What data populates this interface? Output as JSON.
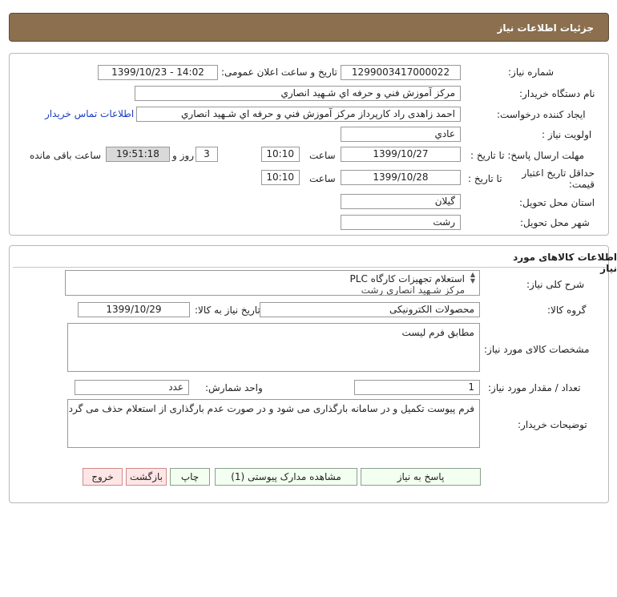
{
  "header": {
    "title": "جزئیات اطلاعات نیاز"
  },
  "details": {
    "need_number_label": "شماره نیاز:",
    "need_number": "1299003417000022",
    "announce_label": "تاریخ و ساعت اعلان عمومی:",
    "announce_value": "1399/10/23 - 14:02",
    "buyer_org_label": "نام دستگاه خریدار:",
    "buyer_org": "مرکز آموزش فني و حرفه اي شـهيد انصاري",
    "requester_label": "ایجاد کننده درخواست:",
    "requester": "احمد زاهدی راد کارپرداز مرکز آموزش فني و حرفه اي شـهيد انصاري",
    "contact_link": "اطلاعات تماس خریدار",
    "priority_label": "اولویت نیاز :",
    "priority": "عادي",
    "deadline_label": "مهلت ارسال پاسخ: تا تاریخ :",
    "deadline_date": "1399/10/27",
    "time_label": "ساعت",
    "deadline_time": "10:10",
    "days_label": "روز و",
    "days_value": "3",
    "remaining_label": "ساعت باقی مانده",
    "remaining_time": "19:51:18",
    "validity_label": "حداقل تاریخ اعتبار قیمت:",
    "validity_to_label": "تا تاریخ :",
    "validity_date": "1399/10/28",
    "validity_time_label": "ساعت",
    "validity_time": "10:10",
    "province_label": "استان محل تحویل:",
    "province": "گیلان",
    "city_label": "شهر محل تحویل:",
    "city": "رشت"
  },
  "goods": {
    "section_title": "اطلاعات کالاهای مورد نیاز",
    "summary_label": "شرح کلی نیاز:",
    "summary_line1": "استعلام  تجهیزات کارگاه PLC",
    "summary_line2": "مرکز شـهيد انصاري رشت",
    "group_label": "گروه کالا:",
    "group_value": "محصولات الکترونیکی",
    "need_date_label": "تاریخ نیاز به کالا:",
    "need_date": "1399/10/29",
    "spec_label": "مشخصات کالای مورد نیاز:",
    "spec_value": "مطابق فرم لیست",
    "qty_label": "تعداد / مقدار مورد نیاز:",
    "qty_value": "1",
    "unit_label": "واحد شمارش:",
    "unit_value": "عدد",
    "buyer_notes_label": "توضیحات خریدار:",
    "buyer_notes": "فرم پیوست تکمیل و در سامانه بارگذاری می شود و در صورت عدم بارگذاری از استعلام حذف می گردد."
  },
  "buttons": {
    "reply": "پاسخ به نیاز",
    "attachments": "مشاهده مدارک پیوستی (1)",
    "print": "چاپ",
    "back": "بازگشت",
    "exit": "خروج"
  }
}
